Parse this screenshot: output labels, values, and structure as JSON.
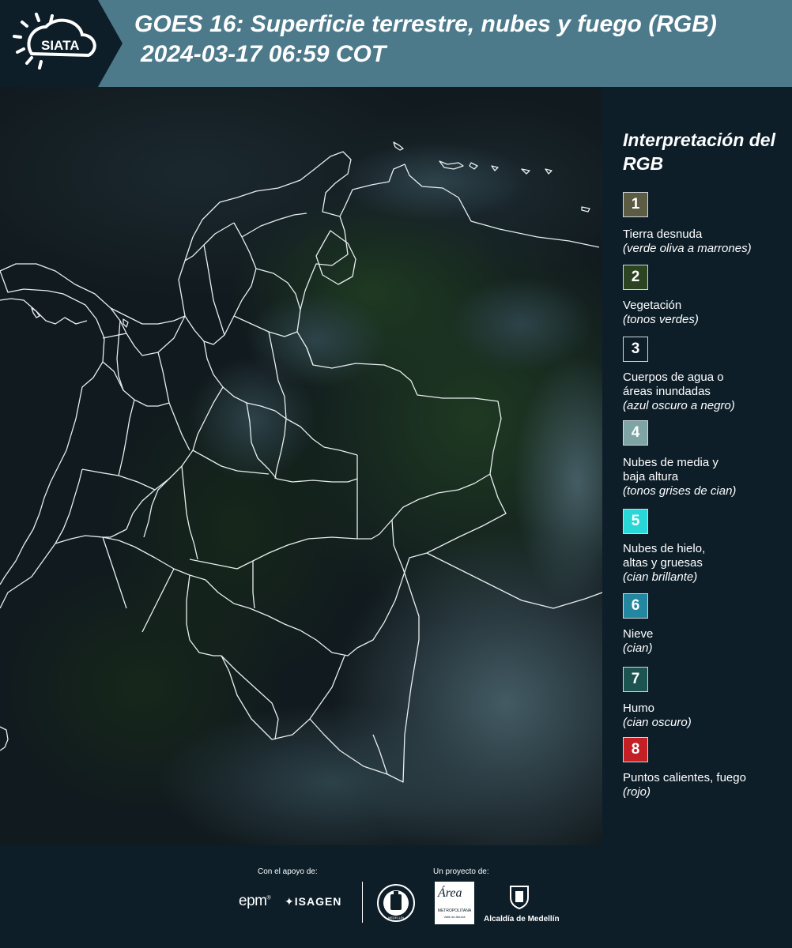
{
  "header": {
    "org_logo_text": "SIATA",
    "title_line1": "GOES 16: Superficie terrestre, nubes y fuego (RGB)",
    "title_line2": "2024-03-17 06:59 COT"
  },
  "legend": {
    "title": "Interpretación del RGB",
    "items": [
      {
        "number": "1",
        "color": "#5c5c44",
        "label": "Tierra desnuda",
        "desc": "(verde oliva a marrones)"
      },
      {
        "number": "2",
        "color": "#2c4422",
        "label": "Vegetación",
        "desc": "(tonos verdes)"
      },
      {
        "number": "3",
        "color": "#0d1e29",
        "label": "Cuerpos de agua o áreas inundadas",
        "desc": "(azul oscuro a negro)"
      },
      {
        "number": "4",
        "color": "#7fa4a6",
        "label": "Nubes de media y baja altura",
        "desc": "(tonos grises de cian)"
      },
      {
        "number": "5",
        "color": "#29d8d6",
        "label": "Nubes de hielo, altas y gruesas",
        "desc": "(cian brillante)"
      },
      {
        "number": "6",
        "color": "#2487a0",
        "label": "Nieve",
        "desc": "(cian)"
      },
      {
        "number": "7",
        "color": "#1c5452",
        "label": "Humo",
        "desc": "(cian oscuro)"
      },
      {
        "number": "8",
        "color": "#c51f26",
        "label": "Puntos calientes, fuego",
        "desc": "(rojo)"
      }
    ]
  },
  "footer": {
    "support_caption": "Con el apoyo de:",
    "project_caption": "Un proyecto de:",
    "logos": {
      "epm": "epm",
      "isagen": "ISAGEN",
      "area_metro": "Área",
      "area_metro_sub": "METROPOLITANA",
      "area_metro_sub2": "Valle de Aburrá",
      "alcaldia": "Alcaldía de Medellín",
      "university_seal": "MEDELLÍN"
    }
  }
}
